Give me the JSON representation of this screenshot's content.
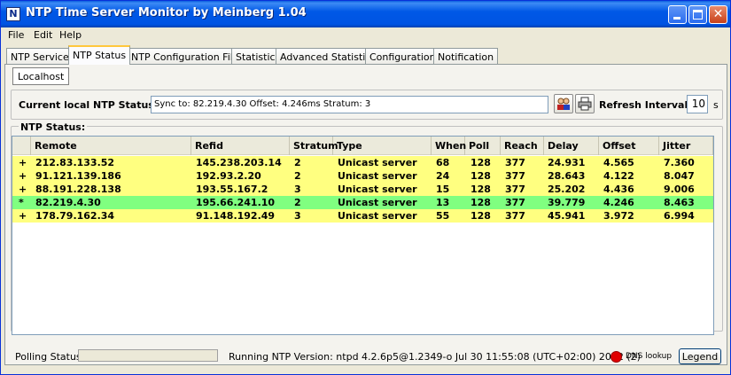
{
  "window": {
    "title": "NTP Time Server Monitor by Meinberg 1.04"
  },
  "menu": [
    "File",
    "Edit",
    "Help"
  ],
  "tabs": [
    "NTP Service",
    "NTP Status",
    "NTP Configuration File",
    "Statistic",
    "Advanced Statistic",
    "Configuration",
    "Notification"
  ],
  "active_tab": "NTP Status",
  "subtab": "Localhost",
  "status": {
    "label": "Current local NTP Status:",
    "value": "Sync to: 82.219.4.30   Offset: 4.246ms   Stratum: 3",
    "refresh_label": "Refresh Intervall:",
    "refresh_value": "10",
    "refresh_unit": "s"
  },
  "ntp": {
    "group_title": "NTP Status:",
    "columns": [
      "Remote",
      "Refid",
      "Stratum",
      "Type",
      "When",
      "Poll",
      "Reach",
      "Delay",
      "Offset",
      "Jitter"
    ],
    "rows": [
      {
        "flag": "+",
        "remote": "212.83.133.52",
        "refid": "145.238.203.14",
        "stratum": "2",
        "type": "Unicast server",
        "when": "68",
        "poll": "128",
        "reach": "377",
        "delay": "24.931",
        "offset": "4.565",
        "jitter": "7.360",
        "color": "#ffff80"
      },
      {
        "flag": "+",
        "remote": "91.121.139.186",
        "refid": "192.93.2.20",
        "stratum": "2",
        "type": "Unicast server",
        "when": "24",
        "poll": "128",
        "reach": "377",
        "delay": "28.643",
        "offset": "4.122",
        "jitter": "8.047",
        "color": "#ffff80"
      },
      {
        "flag": "+",
        "remote": "88.191.228.138",
        "refid": "193.55.167.2",
        "stratum": "3",
        "type": "Unicast server",
        "when": "15",
        "poll": "128",
        "reach": "377",
        "delay": "25.202",
        "offset": "4.436",
        "jitter": "9.006",
        "color": "#ffff80"
      },
      {
        "flag": "*",
        "remote": "82.219.4.30",
        "refid": "195.66.241.10",
        "stratum": "2",
        "type": "Unicast server",
        "when": "13",
        "poll": "128",
        "reach": "377",
        "delay": "39.779",
        "offset": "4.246",
        "jitter": "8.463",
        "color": "#80ff80"
      },
      {
        "flag": "+",
        "remote": "178.79.162.34",
        "refid": "91.148.192.49",
        "stratum": "3",
        "type": "Unicast server",
        "when": "55",
        "poll": "128",
        "reach": "377",
        "delay": "45.941",
        "offset": "3.972",
        "jitter": "6.994",
        "color": "#ffff80"
      }
    ]
  },
  "statusbar": {
    "polling_label": "Polling Status:",
    "version": "Running NTP Version:  ntpd 4.2.6p5@1.2349-o Jul 30 11:55:08 (UTC+02:00) 2012  (2)",
    "dns_label": "DNS lookup",
    "legend_label": "Legend"
  },
  "icons": {
    "app": "app-icon",
    "sync": "people-icon",
    "print": "printer-icon",
    "dns_status": "status-dot-icon"
  }
}
